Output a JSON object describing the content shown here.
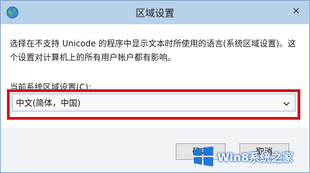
{
  "window": {
    "title": "区域设置",
    "close_glyph": "×"
  },
  "content": {
    "description": "选择在不支持 Unicode 的程序中显示文本时所使用的语言(系统区域设置)。这个设置对计算机上的所有用户帐户都有影响。",
    "field_label": "当前系统区域设置(C):",
    "select_value": "中文(简体，中国)"
  },
  "buttons": {
    "ok_label": "确定",
    "cancel_label": "取消"
  },
  "watermark": {
    "text": "Win8系统之家"
  },
  "colors": {
    "titlebar": "#b8d1ea",
    "highlight": "#d21420",
    "watermark_blue": "#0b4fb0"
  },
  "icons": {
    "app": "globe-icon",
    "dropdown": "chevron-down-icon",
    "close": "close-icon",
    "logo": "windows-logo-icon"
  }
}
